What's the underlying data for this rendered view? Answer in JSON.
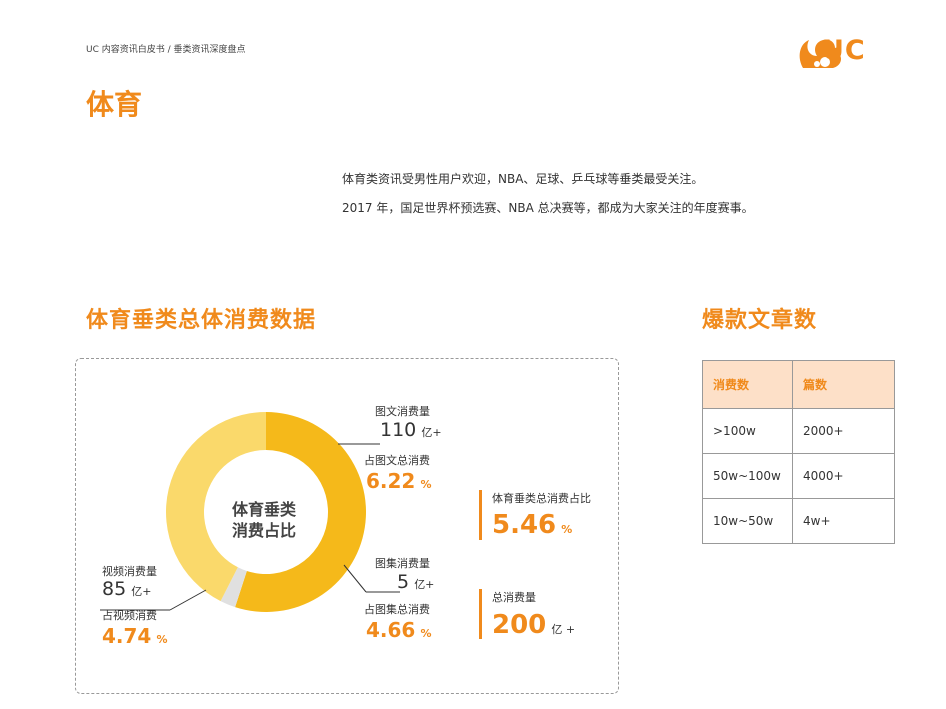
{
  "header": {
    "breadcrumb": "UC 内容资讯白皮书 / 垂类资讯深度盘点",
    "logo_text": "UC",
    "page_title": "体育"
  },
  "intro": {
    "line1": "体育类资讯受男性用户欢迎，NBA、足球、乒乓球等垂类最受关注。",
    "line2": "2017 年，国足世界杯预选赛、NBA 总决赛等，都成为大家关注的年度赛事。"
  },
  "section": {
    "title": "体育垂类总体消费数据",
    "donut_center_line1": "体育垂类",
    "donut_center_line2": "消费占比"
  },
  "chart_data": {
    "type": "pie",
    "series": [
      {
        "name": "图文",
        "value": 110,
        "color": "#f5b91a"
      },
      {
        "name": "图集",
        "value": 5,
        "color": "#e0e0e0"
      },
      {
        "name": "视频",
        "value": 85,
        "color": "#fad96b"
      }
    ]
  },
  "labels": {
    "text": {
      "title": "图文消费量",
      "value": "110",
      "unit": "亿+",
      "share_title": "占图文总消费",
      "share": "6.22",
      "pct": "%"
    },
    "gallery": {
      "title": "图集消费量",
      "value": "5",
      "unit": "亿+",
      "share_title": "占图集总消费",
      "share": "4.66",
      "pct": "%"
    },
    "video": {
      "title": "视频消费量",
      "value": "85",
      "unit": "亿+",
      "share_title": "占视频消费",
      "share": "4.74",
      "pct": "%"
    }
  },
  "stats": {
    "share_label": "体育垂类总消费占比",
    "share_value": "5.46",
    "share_unit": "%",
    "total_label": "总消费量",
    "total_value": "200",
    "total_unit": "亿 +"
  },
  "table": {
    "title": "爆款文章数",
    "headers": [
      "消费数",
      "篇数"
    ],
    "rows": [
      [
        ">100w",
        "2000+"
      ],
      [
        "50w~100w",
        "4000+"
      ],
      [
        "10w~50w",
        "4w+"
      ]
    ]
  },
  "colors": {
    "accent": "#f08a1c",
    "header_bg": "#fde0c8"
  }
}
